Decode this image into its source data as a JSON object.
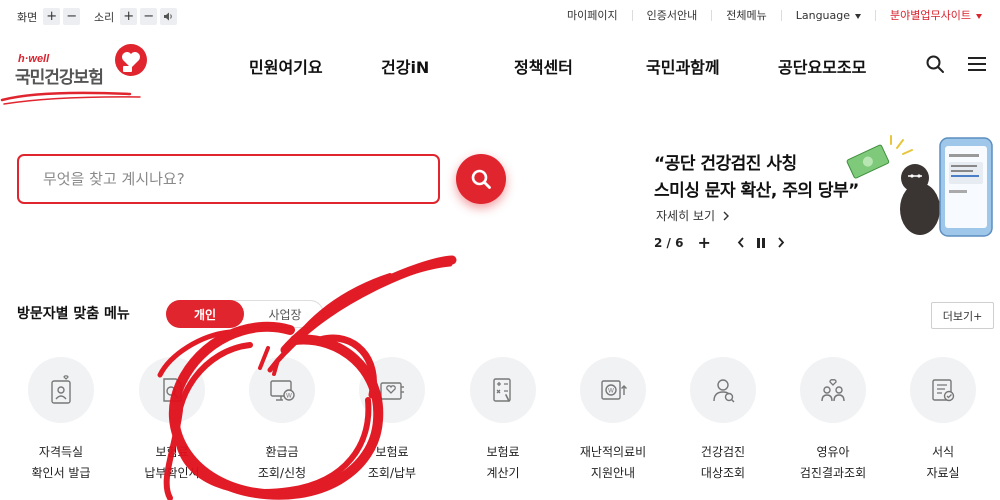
{
  "util": {
    "screen_label": "화면",
    "sound_label": "소리",
    "plus": "+",
    "minus": "−",
    "links": {
      "mypage": "마이페이지",
      "cert": "인증서안내",
      "allmenu": "전체메뉴",
      "language": "Language",
      "field_sites": "분야별업무사이트"
    }
  },
  "logo": {
    "tagline": "h·well",
    "name": "국민건강보험"
  },
  "gnb": {
    "item1": "민원여기요",
    "item2": "건강iN",
    "item3": "정책센터",
    "item4": "국민과함께",
    "item5": "공단요모조모"
  },
  "search": {
    "placeholder": "무엇을 찾고 계시나요?"
  },
  "banner": {
    "title_line1": "“공단 건강검진 사칭",
    "title_line2": "스미싱 문자 확산, 주의 당부”",
    "more": "자세히 보기",
    "page": "2 / 6",
    "add": "+"
  },
  "quick": {
    "title": "방문자별 맞춤 메뉴",
    "tab_personal": "개인",
    "tab_business": "사업장",
    "more": "더보기+",
    "items": [
      {
        "line1": "자격득실",
        "line2": "확인서 발급",
        "icon": "id-card-heart-icon"
      },
      {
        "line1": "보험료",
        "line2": "납부확인서",
        "icon": "document-search-icon"
      },
      {
        "line1": "환급금",
        "line2": "조회/신청",
        "icon": "monitor-won-icon"
      },
      {
        "line1": "보험료",
        "line2": "조회/납부",
        "icon": "receipt-heart-icon"
      },
      {
        "line1": "보험료",
        "line2": "계산기",
        "icon": "calculator-icon"
      },
      {
        "line1": "재난적의료비",
        "line2": "지원안내",
        "icon": "won-box-icon"
      },
      {
        "line1": "건강검진",
        "line2": "대상조회",
        "icon": "person-search-icon"
      },
      {
        "line1": "영유아",
        "line2": "검진결과조회",
        "icon": "family-heart-icon"
      },
      {
        "line1": "서식",
        "line2": "자료실",
        "icon": "form-check-icon"
      }
    ]
  },
  "colors": {
    "brand_red": "#e0252e",
    "icon_gray": "#777777",
    "circle_bg": "#f1f2f4"
  }
}
